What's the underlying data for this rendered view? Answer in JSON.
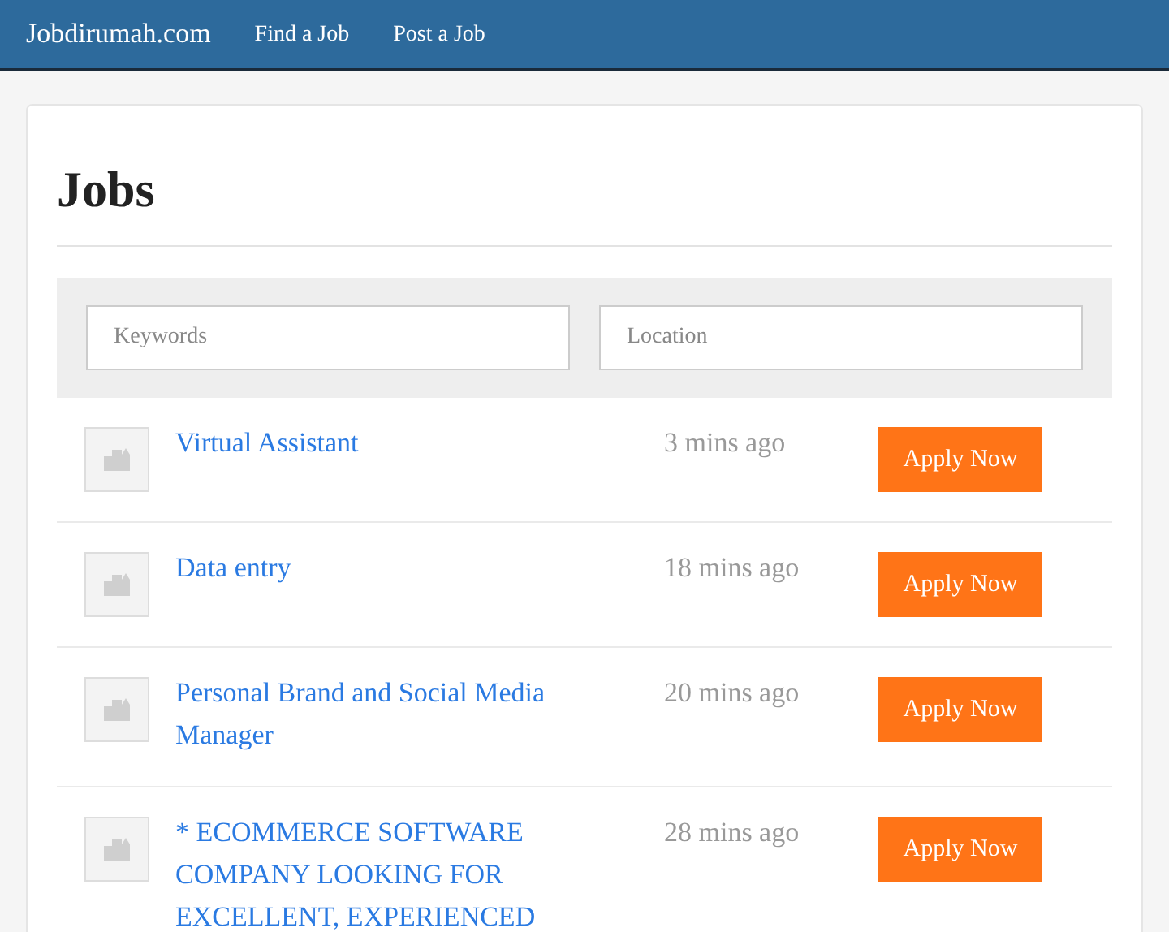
{
  "navbar": {
    "brand": "Jobdirumah.com",
    "links": [
      {
        "label": "Find a Job"
      },
      {
        "label": "Post a Job"
      }
    ]
  },
  "page": {
    "title": "Jobs"
  },
  "search": {
    "keywords_placeholder": "Keywords",
    "location_placeholder": "Location"
  },
  "jobs": [
    {
      "title": "Virtual Assistant",
      "posted": "3 mins ago",
      "action": "Apply Now"
    },
    {
      "title": "Data entry",
      "posted": "18 mins ago",
      "action": "Apply Now"
    },
    {
      "title": "Personal Brand and Social Media Manager",
      "posted": "20 mins ago",
      "action": "Apply Now"
    },
    {
      "title": "* ECOMMERCE SOFTWARE COMPANY LOOKING FOR EXCELLENT, EXPERIENCED",
      "posted": "28 mins ago",
      "action": "Apply Now"
    }
  ]
}
